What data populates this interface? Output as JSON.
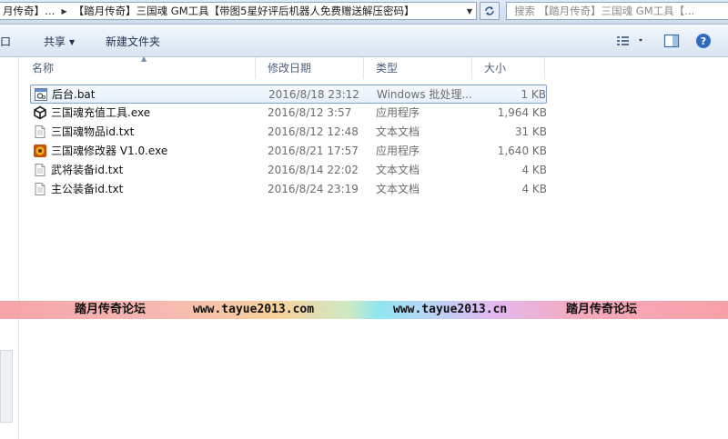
{
  "address_bar": {
    "crumbs": [
      "月传奇】…",
      "【踏月传奇】三国魂 GM工具【带图5星好评后机器人免费赠送解压密码】"
    ],
    "search_placeholder": "搜索 【踏月传奇】三国魂 GM工具【..."
  },
  "toolbar": {
    "left_edge_label": "口",
    "share_label": "共享",
    "new_folder_label": "新建文件夹"
  },
  "columns": {
    "name": "名称",
    "modified": "修改日期",
    "type": "类型",
    "size": "大小"
  },
  "files": [
    {
      "name": "后台.bat",
      "modified": "2016/8/18 23:12",
      "type": "Windows 批处理...",
      "size": "1 KB",
      "icon": "batch-file-icon",
      "selected": true
    },
    {
      "name": "三国魂充值工具.exe",
      "modified": "2016/8/12 3:57",
      "type": "应用程序",
      "size": "1,964 KB",
      "icon": "unity-app-icon",
      "selected": false
    },
    {
      "name": "三国魂物品id.txt",
      "modified": "2016/8/12 12:48",
      "type": "文本文档",
      "size": "31 KB",
      "icon": "text-file-icon",
      "selected": false
    },
    {
      "name": "三国魂修改器 V1.0.exe",
      "modified": "2016/8/21 17:57",
      "type": "应用程序",
      "size": "1,640 KB",
      "icon": "trainer-app-icon",
      "selected": false
    },
    {
      "name": "武将装备id.txt",
      "modified": "2016/8/14 22:02",
      "type": "文本文档",
      "size": "4 KB",
      "icon": "text-file-icon",
      "selected": false
    },
    {
      "name": "主公装备id.txt",
      "modified": "2016/8/24 23:19",
      "type": "文本文档",
      "size": "4 KB",
      "icon": "text-file-icon",
      "selected": false
    }
  ],
  "watermark": {
    "forum_left": "踏月传奇论坛",
    "url_com": "www.tayue2013.com",
    "url_cn": "www.tayue2013.cn",
    "forum_right": "踏月传奇论坛"
  },
  "colors": {
    "toolbar_text": "#1e3050",
    "selection_border": "#7da2ce",
    "secondary_text": "#6d6d6d"
  }
}
